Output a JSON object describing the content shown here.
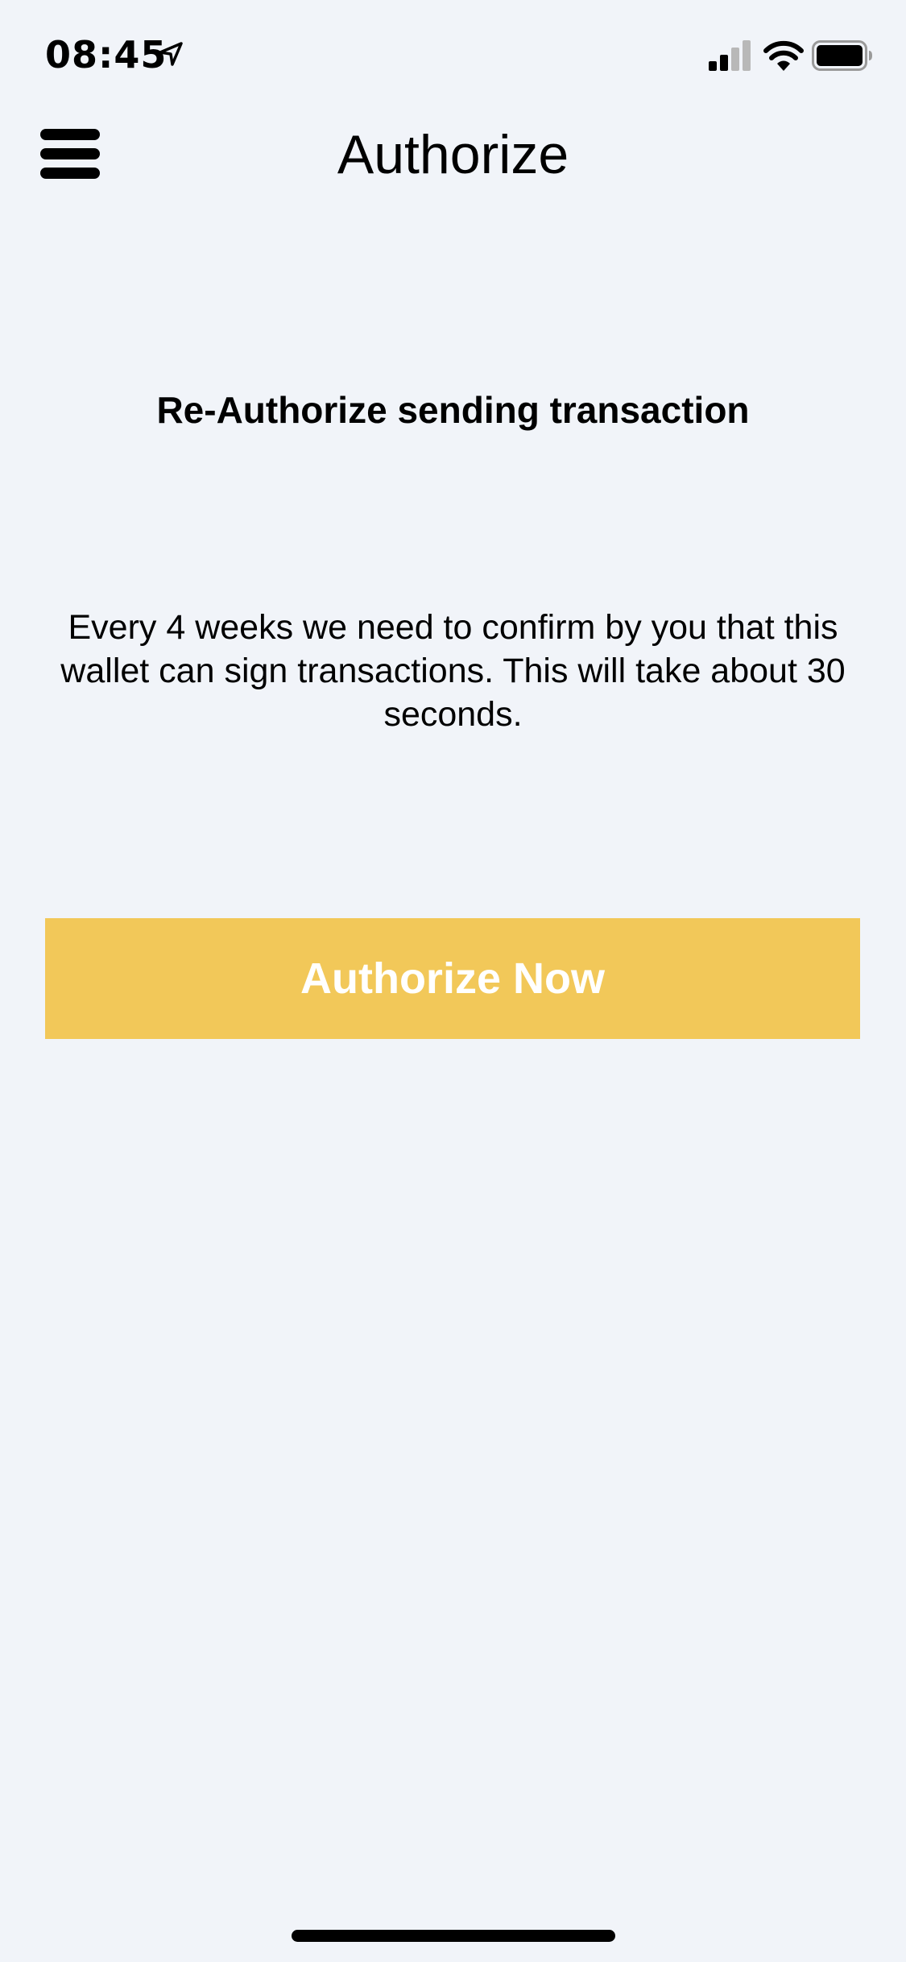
{
  "status_bar": {
    "time": "08:45",
    "location_icon": "location-arrow-icon",
    "signal_icon": "cellular-signal-icon",
    "wifi_icon": "wifi-icon",
    "battery_icon": "battery-icon"
  },
  "nav": {
    "menu_icon": "hamburger-menu-icon",
    "title": "Authorize"
  },
  "main": {
    "heading": "Re-Authorize sending transaction",
    "description": "Every 4 weeks we need to confirm by you that this wallet can sign transactions. This will take about 30 seconds.",
    "button_label": "Authorize Now"
  },
  "colors": {
    "background": "#f1f4f9",
    "button": "#f2c859",
    "button_text": "#ffffff",
    "text": "#000000"
  }
}
